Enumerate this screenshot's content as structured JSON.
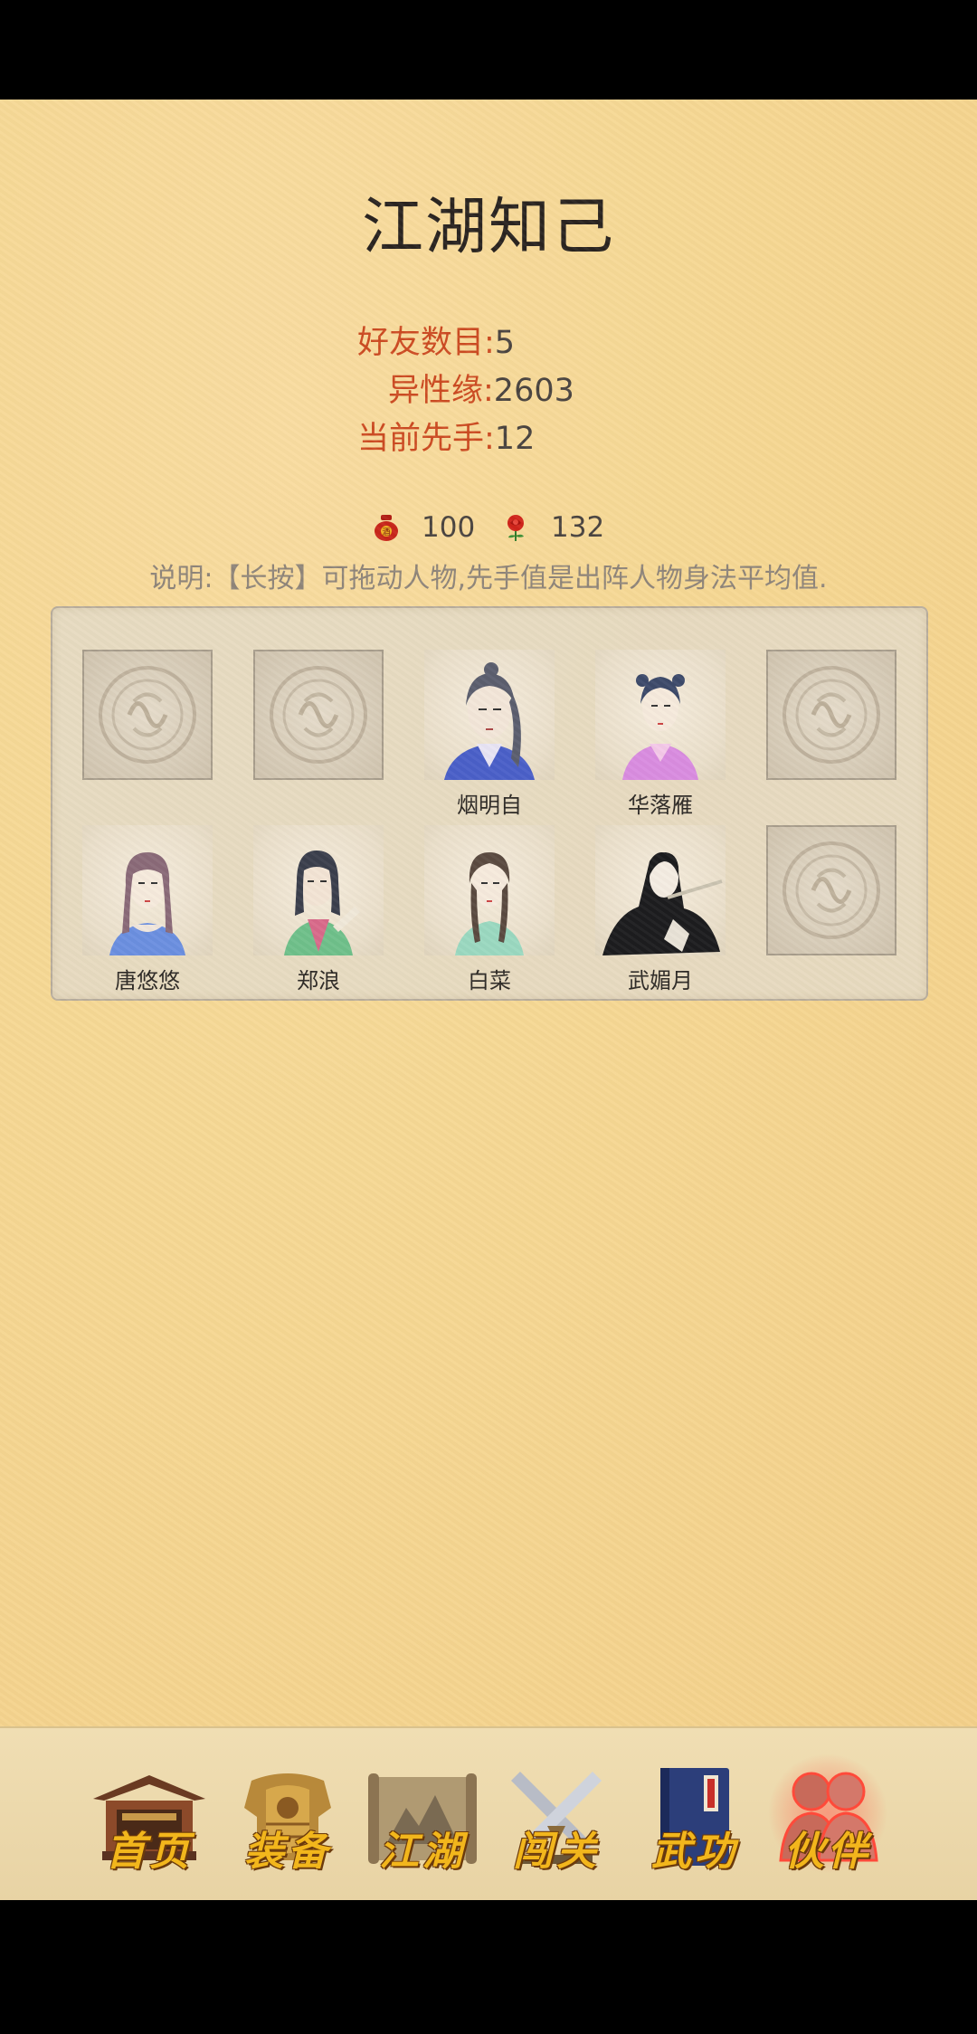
{
  "header": {
    "title": "江湖知己"
  },
  "stats": {
    "friends": {
      "label": "好友数目:",
      "value": "5"
    },
    "romance": {
      "label": "异性缘:",
      "value": "2603"
    },
    "initiative": {
      "label": "当前先手:",
      "value": "12"
    }
  },
  "currency": {
    "wine": {
      "icon": "wine-jar-icon",
      "value": "100"
    },
    "rose": {
      "icon": "rose-icon",
      "value": "132"
    }
  },
  "note": "说明:【长按】可拖动人物,先手值是出阵人物身法平均值.",
  "lineup": {
    "row1": [
      {
        "name": "",
        "empty": true
      },
      {
        "name": "",
        "empty": true
      },
      {
        "name": "烟明自",
        "empty": false
      },
      {
        "name": "华落雁",
        "empty": false
      },
      {
        "name": "",
        "empty": true
      }
    ],
    "row2": [
      {
        "name": "唐悠悠",
        "empty": false
      },
      {
        "name": "郑浪",
        "empty": false
      },
      {
        "name": "白菜",
        "empty": false
      },
      {
        "name": "武媚月",
        "empty": false
      },
      {
        "name": "",
        "empty": true
      }
    ]
  },
  "nav": {
    "items": [
      {
        "label": "首页",
        "icon": "house-icon"
      },
      {
        "label": "装备",
        "icon": "armor-icon"
      },
      {
        "label": "江湖",
        "icon": "scroll-map-icon"
      },
      {
        "label": "闯关",
        "icon": "crossed-swords-icon"
      },
      {
        "label": "武功",
        "icon": "book-icon"
      },
      {
        "label": "伙伴",
        "icon": "partners-icon"
      }
    ],
    "active_index": 5
  },
  "colors": {
    "label_red": "#cc4b22",
    "nav_gold": "#f2b61c",
    "background": "#f6d894"
  }
}
